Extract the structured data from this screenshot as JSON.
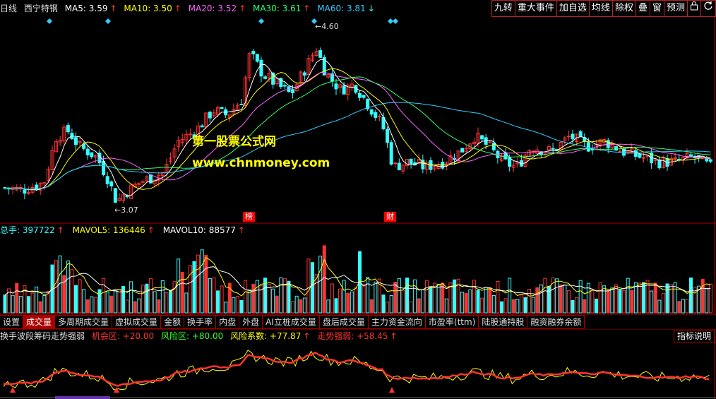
{
  "header": {
    "period": "日线",
    "stock_name": "西宁特钢",
    "ma5_label": "MA5: 3.59",
    "ma10_label": "MA10: 3.50",
    "ma20_label": "MA20: 3.52",
    "ma30_label": "MA30: 3.61",
    "ma60_label": "MA60: 3.81",
    "colors": {
      "ma5": "#ffffff",
      "ma10": "#ffff00",
      "ma20": "#ff66ff",
      "ma30": "#33ff66",
      "ma60": "#33ccff",
      "up": "#ff3333",
      "down": "#33ffff"
    }
  },
  "toolbar": {
    "items": [
      "九转",
      "重大事件",
      "加自选",
      "均线",
      "除权",
      "叠",
      "窗",
      "预测",
      "lock-icon",
      "refresh-icon"
    ]
  },
  "watermark": {
    "line1": "第一股票公式网",
    "line2": "www.chnmoney.com"
  },
  "price_chart": {
    "high_label": "4.60",
    "low_label": "3.07",
    "tag_1": "榜",
    "tag_2": "财",
    "price_range": [
      2.9,
      4.85
    ]
  },
  "volume_header": {
    "total": "总手: 397722",
    "mavol5": "MAVOL5: 136446",
    "mavol10": "MAVOL10: 88577"
  },
  "tabs": [
    "设置",
    "成交量",
    "多周期成交量",
    "虚拟成交量",
    "金额",
    "换手率",
    "内盘",
    "外盘",
    "AI立桩成交量",
    "盘后成交量",
    "主力资金流向",
    "市盈率(ttm)",
    "陆股通持股",
    "融资融券余额"
  ],
  "active_tab": "成交量",
  "indicator": {
    "name": "换手波段筹码走势强弱",
    "opp_zone": "机会区: +20.00",
    "risk_zone": "风险区: +80.00",
    "risk_coef": "风险系数: +77.87",
    "trend_strength": "走势强弱: +58.45",
    "help_button": "指标说明"
  }
}
